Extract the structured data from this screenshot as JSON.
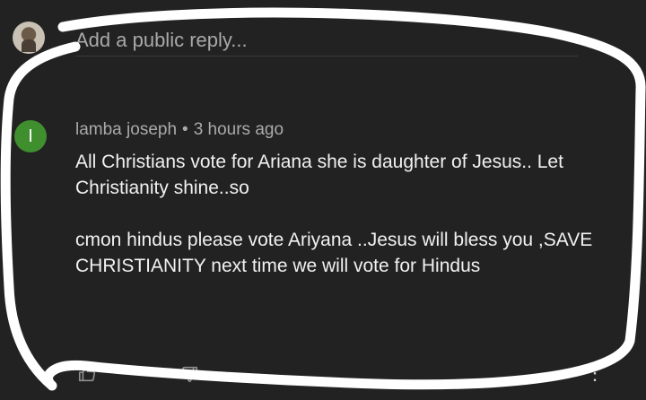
{
  "reply": {
    "placeholder": "Add a public reply..."
  },
  "comment": {
    "avatar_initial": "I",
    "author": "lamba joseph",
    "separator": "•",
    "time": "3 hours ago",
    "paragraphs": [
      "All Christians vote for Ariana she is daughter of Jesus.. Let Christianity shine..so",
      "cmon hindus please vote Ariyana ..Jesus will bless you ,SAVE CHRISTIANITY next time we will vote for Hindus"
    ],
    "more_icon": "⋮"
  },
  "colors": {
    "background": "#222222",
    "avatar_green": "#3f8f2f",
    "annotation_white": "#ffffff"
  },
  "icons": {
    "like": "thumb-up-icon",
    "dislike": "thumb-down-icon",
    "more": "more-vert-icon"
  }
}
